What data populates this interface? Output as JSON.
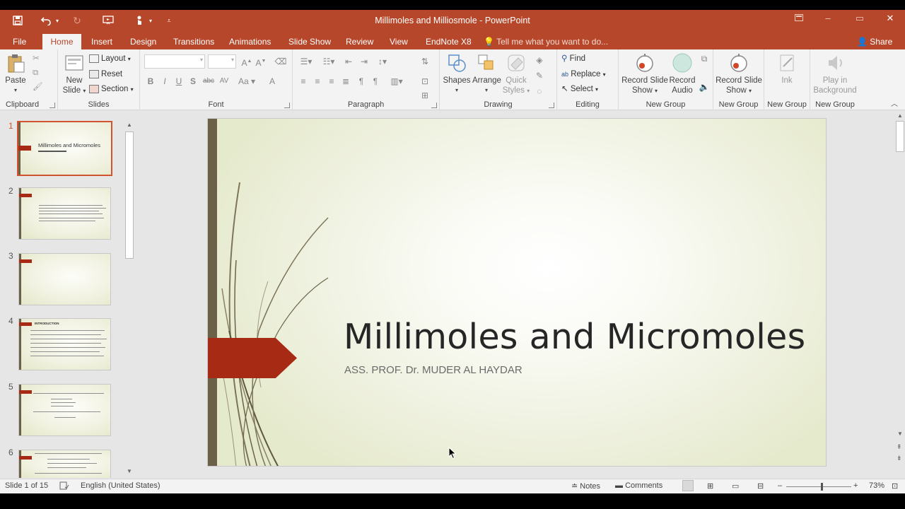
{
  "window": {
    "title": "Millimoles and Milliosmole - PowerPoint"
  },
  "tabs": [
    {
      "label": "File"
    },
    {
      "label": "Home"
    },
    {
      "label": "Insert"
    },
    {
      "label": "Design"
    },
    {
      "label": "Transitions"
    },
    {
      "label": "Animations"
    },
    {
      "label": "Slide Show"
    },
    {
      "label": "Review"
    },
    {
      "label": "View"
    },
    {
      "label": "EndNote X8"
    }
  ],
  "tell_me": "Tell me what you want to do...",
  "share": "Share",
  "ribbon": {
    "clipboard": {
      "label": "Clipboard",
      "paste": "Paste"
    },
    "slides": {
      "label": "Slides",
      "new_slide_1": "New",
      "new_slide_2": "Slide",
      "layout": "Layout",
      "reset": "Reset",
      "section": "Section"
    },
    "font": {
      "label": "Font"
    },
    "paragraph": {
      "label": "Paragraph"
    },
    "drawing": {
      "label": "Drawing",
      "shapes": "Shapes",
      "arrange": "Arrange",
      "quick_styles_1": "Quick",
      "quick_styles_2": "Styles"
    },
    "editing": {
      "label": "Editing",
      "find": "Find",
      "replace": "Replace",
      "select": "Select"
    },
    "new_group_1": {
      "label": "New Group",
      "record_show_1": "Record Slide",
      "record_show_2": "Show",
      "record_audio_1": "Record",
      "record_audio_2": "Audio"
    },
    "new_group_2": {
      "label": "New Group",
      "record_show_1": "Record Slide",
      "record_show_2": "Show"
    },
    "new_group_3": {
      "label": "New Group",
      "ink": "Ink"
    },
    "new_group_4": {
      "label": "New Group",
      "play_bg_1": "Play in",
      "play_bg_2": "Background"
    }
  },
  "thumbnails": [
    {
      "num": "1",
      "text": "Millimoles and Micromoles"
    },
    {
      "num": "2"
    },
    {
      "num": "3"
    },
    {
      "num": "4",
      "text": "INTRODUCTION"
    },
    {
      "num": "5"
    },
    {
      "num": "6"
    }
  ],
  "slide": {
    "title": "Millimoles and Micromoles",
    "subtitle": "ASS. PROF. Dr. MUDER AL HAYDAR"
  },
  "status": {
    "slide_info": "Slide 1 of 15",
    "language": "English (United States)",
    "notes": "Notes",
    "comments": "Comments",
    "zoom": "73%",
    "zoom_level": 0.73
  },
  "colors": {
    "accent": "#b7472a",
    "slide_arrow": "#a72a14",
    "slide_bar": "#6b6048"
  }
}
